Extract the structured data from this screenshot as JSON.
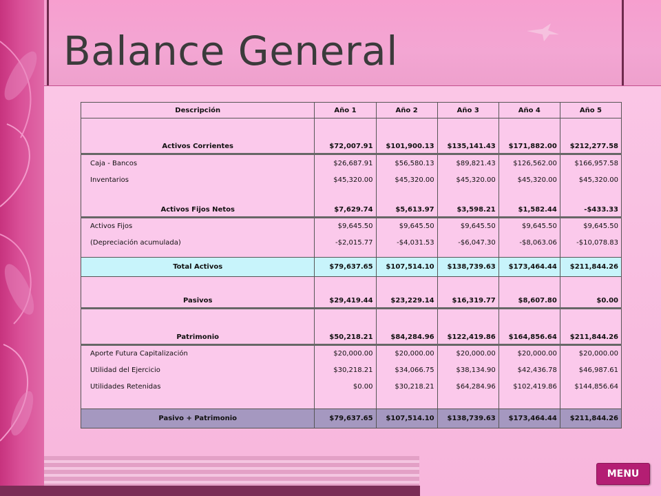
{
  "page": {
    "title": "Balance General"
  },
  "table": {
    "headers": [
      "Descripción",
      "Año 1",
      "Año 2",
      "Año 3",
      "Año 4",
      "Año 5"
    ],
    "activos_corrientes": {
      "label": "Activos Corrientes",
      "values": [
        "$72,007.91",
        "$101,900.13",
        "$135,141.43",
        "$171,882.00",
        "$212,277.58"
      ]
    },
    "caja_bancos": {
      "label": "Caja - Bancos",
      "values": [
        "$26,687.91",
        "$56,580.13",
        "$89,821.43",
        "$126,562.00",
        "$166,957.58"
      ]
    },
    "inventarios": {
      "label": "Inventarios",
      "values": [
        "$45,320.00",
        "$45,320.00",
        "$45,320.00",
        "$45,320.00",
        "$45,320.00"
      ]
    },
    "activos_fijos_netos": {
      "label": "Activos Fijos Netos",
      "values": [
        "$7,629.74",
        "$5,613.97",
        "$3,598.21",
        "$1,582.44",
        "-$433.33"
      ]
    },
    "activos_fijos": {
      "label": "Activos Fijos",
      "values": [
        "$9,645.50",
        "$9,645.50",
        "$9,645.50",
        "$9,645.50",
        "$9,645.50"
      ]
    },
    "depreciacion": {
      "label": "(Depreciación acumulada)",
      "values": [
        "-$2,015.77",
        "-$4,031.53",
        "-$6,047.30",
        "-$8,063.06",
        "-$10,078.83"
      ]
    },
    "total_activos": {
      "label": "Total Activos",
      "values": [
        "$79,637.65",
        "$107,514.10",
        "$138,739.63",
        "$173,464.44",
        "$211,844.26"
      ]
    },
    "pasivos": {
      "label": "Pasivos",
      "values": [
        "$29,419.44",
        "$23,229.14",
        "$16,319.77",
        "$8,607.80",
        "$0.00"
      ]
    },
    "patrimonio": {
      "label": "Patrimonio",
      "values": [
        "$50,218.21",
        "$84,284.96",
        "$122,419.86",
        "$164,856.64",
        "$211,844.26"
      ]
    },
    "aporte": {
      "label": "Aporte Futura Capitalización",
      "values": [
        "$20,000.00",
        "$20,000.00",
        "$20,000.00",
        "$20,000.00",
        "$20,000.00"
      ]
    },
    "utilidad_ejercicio": {
      "label": "Utilidad del Ejercicio",
      "values": [
        "$30,218.21",
        "$34,066.75",
        "$38,134.90",
        "$42,436.78",
        "$46,987.61"
      ]
    },
    "utilidades_retenidas": {
      "label": "Utilidades Retenidas",
      "values": [
        "$0.00",
        "$30,218.21",
        "$64,284.96",
        "$102,419.86",
        "$144,856.64"
      ]
    },
    "pasivo_patrimonio": {
      "label": "Pasivo + Patrimonio",
      "values": [
        "$79,637.65",
        "$107,514.10",
        "$138,739.63",
        "$173,464.44",
        "$211,844.26"
      ]
    }
  },
  "menu": {
    "label": "MENU"
  },
  "colors": {
    "accent": "#b41e73",
    "total_row": "#c8f4fb",
    "final_row": "#a598c0",
    "table_bg": "#fbc9eb"
  }
}
